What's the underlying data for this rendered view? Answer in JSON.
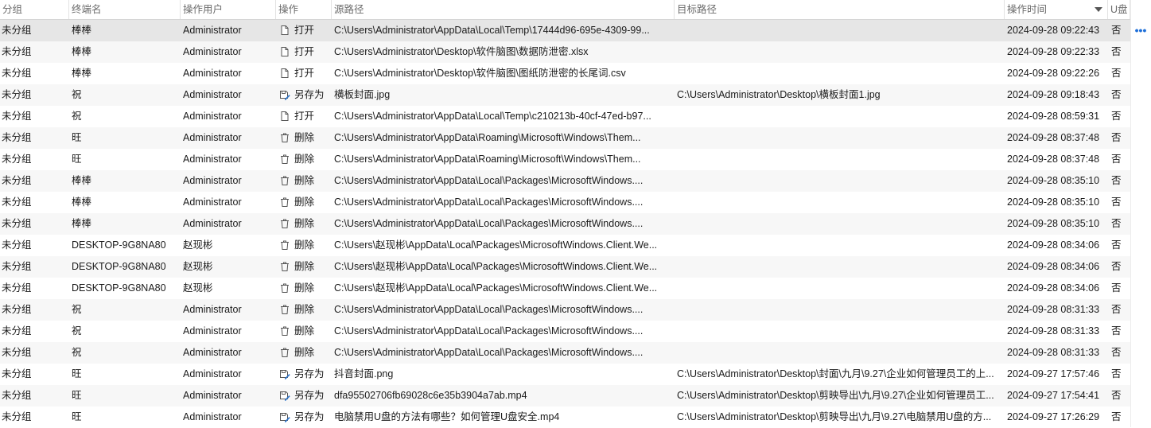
{
  "columns": {
    "group": "分组",
    "terminal": "终端名",
    "user": "操作用户",
    "operation": "操作",
    "source": "源路径",
    "target": "目标路径",
    "time": "操作时间",
    "usb": "U盘"
  },
  "sort": {
    "column": "time",
    "direction": "desc"
  },
  "more_label": "•••",
  "rows": [
    {
      "group": "未分组",
      "terminal": "棒棒",
      "user": "Administrator",
      "op_icon": "file-open-icon",
      "op": "打开",
      "src": "C:\\Users\\Administrator\\AppData\\Local\\Temp\\17444d96-695e-4309-99...",
      "dst": "",
      "time": "2024-09-28 09:22:43",
      "usb": "否"
    },
    {
      "group": "未分组",
      "terminal": "棒棒",
      "user": "Administrator",
      "op_icon": "file-open-icon",
      "op": "打开",
      "src": "C:\\Users\\Administrator\\Desktop\\软件脑图\\数据防泄密.xlsx",
      "dst": "",
      "time": "2024-09-28 09:22:33",
      "usb": "否"
    },
    {
      "group": "未分组",
      "terminal": "棒棒",
      "user": "Administrator",
      "op_icon": "file-open-icon",
      "op": "打开",
      "src": "C:\\Users\\Administrator\\Desktop\\软件脑图\\图纸防泄密的长尾词.csv",
      "dst": "",
      "time": "2024-09-28 09:22:26",
      "usb": "否"
    },
    {
      "group": "未分组",
      "terminal": "祝",
      "user": "Administrator",
      "op_icon": "save-as-icon",
      "op": "另存为",
      "src": "横板封面.jpg",
      "dst": "C:\\Users\\Administrator\\Desktop\\横板封面1.jpg",
      "time": "2024-09-28 09:18:43",
      "usb": "否"
    },
    {
      "group": "未分组",
      "terminal": "祝",
      "user": "Administrator",
      "op_icon": "file-open-icon",
      "op": "打开",
      "src": "C:\\Users\\Administrator\\AppData\\Local\\Temp\\c210213b-40cf-47ed-b97...",
      "dst": "",
      "time": "2024-09-28 08:59:31",
      "usb": "否"
    },
    {
      "group": "未分组",
      "terminal": "旺",
      "user": "Administrator",
      "op_icon": "delete-icon",
      "op": "删除",
      "src": "C:\\Users\\Administrator\\AppData\\Roaming\\Microsoft\\Windows\\Them...",
      "dst": "",
      "time": "2024-09-28 08:37:48",
      "usb": "否"
    },
    {
      "group": "未分组",
      "terminal": "旺",
      "user": "Administrator",
      "op_icon": "delete-icon",
      "op": "删除",
      "src": "C:\\Users\\Administrator\\AppData\\Roaming\\Microsoft\\Windows\\Them...",
      "dst": "",
      "time": "2024-09-28 08:37:48",
      "usb": "否"
    },
    {
      "group": "未分组",
      "terminal": "棒棒",
      "user": "Administrator",
      "op_icon": "delete-icon",
      "op": "删除",
      "src": "C:\\Users\\Administrator\\AppData\\Local\\Packages\\MicrosoftWindows....",
      "dst": "",
      "time": "2024-09-28 08:35:10",
      "usb": "否"
    },
    {
      "group": "未分组",
      "terminal": "棒棒",
      "user": "Administrator",
      "op_icon": "delete-icon",
      "op": "删除",
      "src": "C:\\Users\\Administrator\\AppData\\Local\\Packages\\MicrosoftWindows....",
      "dst": "",
      "time": "2024-09-28 08:35:10",
      "usb": "否"
    },
    {
      "group": "未分组",
      "terminal": "棒棒",
      "user": "Administrator",
      "op_icon": "delete-icon",
      "op": "删除",
      "src": "C:\\Users\\Administrator\\AppData\\Local\\Packages\\MicrosoftWindows....",
      "dst": "",
      "time": "2024-09-28 08:35:10",
      "usb": "否"
    },
    {
      "group": "未分组",
      "terminal": "DESKTOP-9G8NA80",
      "user": "赵现彬",
      "op_icon": "delete-icon",
      "op": "删除",
      "src": "C:\\Users\\赵现彬\\AppData\\Local\\Packages\\MicrosoftWindows.Client.We...",
      "dst": "",
      "time": "2024-09-28 08:34:06",
      "usb": "否"
    },
    {
      "group": "未分组",
      "terminal": "DESKTOP-9G8NA80",
      "user": "赵现彬",
      "op_icon": "delete-icon",
      "op": "删除",
      "src": "C:\\Users\\赵现彬\\AppData\\Local\\Packages\\MicrosoftWindows.Client.We...",
      "dst": "",
      "time": "2024-09-28 08:34:06",
      "usb": "否"
    },
    {
      "group": "未分组",
      "terminal": "DESKTOP-9G8NA80",
      "user": "赵现彬",
      "op_icon": "delete-icon",
      "op": "删除",
      "src": "C:\\Users\\赵现彬\\AppData\\Local\\Packages\\MicrosoftWindows.Client.We...",
      "dst": "",
      "time": "2024-09-28 08:34:06",
      "usb": "否"
    },
    {
      "group": "未分组",
      "terminal": "祝",
      "user": "Administrator",
      "op_icon": "delete-icon",
      "op": "删除",
      "src": "C:\\Users\\Administrator\\AppData\\Local\\Packages\\MicrosoftWindows....",
      "dst": "",
      "time": "2024-09-28 08:31:33",
      "usb": "否"
    },
    {
      "group": "未分组",
      "terminal": "祝",
      "user": "Administrator",
      "op_icon": "delete-icon",
      "op": "删除",
      "src": "C:\\Users\\Administrator\\AppData\\Local\\Packages\\MicrosoftWindows....",
      "dst": "",
      "time": "2024-09-28 08:31:33",
      "usb": "否"
    },
    {
      "group": "未分组",
      "terminal": "祝",
      "user": "Administrator",
      "op_icon": "delete-icon",
      "op": "删除",
      "src": "C:\\Users\\Administrator\\AppData\\Local\\Packages\\MicrosoftWindows....",
      "dst": "",
      "time": "2024-09-28 08:31:33",
      "usb": "否"
    },
    {
      "group": "未分组",
      "terminal": "旺",
      "user": "Administrator",
      "op_icon": "save-as-icon",
      "op": "另存为",
      "src": "抖音封面.png",
      "dst": "C:\\Users\\Administrator\\Desktop\\封面\\九月\\9.27\\企业如何管理员工的上...",
      "time": "2024-09-27 17:57:46",
      "usb": "否"
    },
    {
      "group": "未分组",
      "terminal": "旺",
      "user": "Administrator",
      "op_icon": "save-as-icon",
      "op": "另存为",
      "src": "dfa95502706fb69028c6e35b3904a7ab.mp4",
      "dst": "C:\\Users\\Administrator\\Desktop\\剪映导出\\九月\\9.27\\企业如何管理员工...",
      "time": "2024-09-27 17:54:41",
      "usb": "否"
    },
    {
      "group": "未分组",
      "terminal": "旺",
      "user": "Administrator",
      "op_icon": "save-as-icon",
      "op": "另存为",
      "src": "电脑禁用U盘的方法有哪些？如何管理U盘安全.mp4",
      "dst": "C:\\Users\\Administrator\\Desktop\\剪映导出\\九月\\9.27\\电脑禁用U盘的方...",
      "time": "2024-09-27 17:26:29",
      "usb": "否"
    }
  ]
}
